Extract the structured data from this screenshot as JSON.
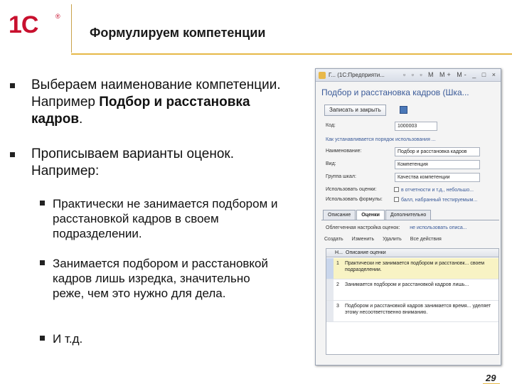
{
  "header": {
    "logo_text": "1С",
    "logo_reg": "®",
    "title": "Формулируем компетенции"
  },
  "bullets": [
    {
      "text_plain": "Выбераем наименование компетенции. Например ",
      "text_bold": "Подбор и расстановка кадров",
      "text_tail": "."
    },
    {
      "text_plain": "Прописываем варианты оценок. Например:"
    }
  ],
  "sub_bullets": [
    "Практически не занимается подбором и расстановкой кадров в своем подразделении.",
    "Занимается подбором и расстановкой кадров лишь изредка, значительно реже, чем это нужно для дела.",
    "И т.д."
  ],
  "window": {
    "title": "Г... (1С:Предприяти...",
    "controls": "▫ ▫ ▫ M M+ M- _ □ ×",
    "form_title": "Подбор и расстановка кадров (Шка...",
    "save_button": "Записать и закрыть",
    "fields": [
      {
        "label": "Код:",
        "value": "1000003"
      },
      {
        "label": "Наименование:",
        "value": "Подбор и расстановка кадров"
      },
      {
        "label": "Вид:",
        "value": "Компетенция"
      },
      {
        "label": "Группа шкал:",
        "value": "Качества компетенции"
      }
    ],
    "link_text": "Как устанавливается порядок использования ...",
    "checks": [
      {
        "label": "Использовать оценки:",
        "link": "в отчетности и т.д., небольшо..."
      },
      {
        "label": "Использовать формулы:",
        "link": "балл, набранный тестируемым..."
      }
    ],
    "tabs": [
      "Описание",
      "Оценки",
      "Дополнительно"
    ],
    "options_label": "Облегченная настройка оценок:",
    "options_link": "не использовать описа...",
    "toolbar": [
      "Создать",
      "Изменить",
      "Удалить",
      "Все действия"
    ],
    "grid_headers": [
      "Н...",
      "Описание оценки"
    ],
    "grid_rows": [
      {
        "n": "1",
        "text": "Практически не занимается подбором и расстановк... своем подразделении."
      },
      {
        "n": "2",
        "text": "Занимается подбором и расстановкой кадров лишь..."
      },
      {
        "n": "3",
        "text": "Подбором и расстановкой кадров занимается время... уделяет этому несоответственно вниманию."
      }
    ]
  },
  "page_number": "29",
  "colors": {
    "logo_red": "#c8102e",
    "accent_gold": "#e6b847",
    "link_blue": "#3a5a98"
  }
}
